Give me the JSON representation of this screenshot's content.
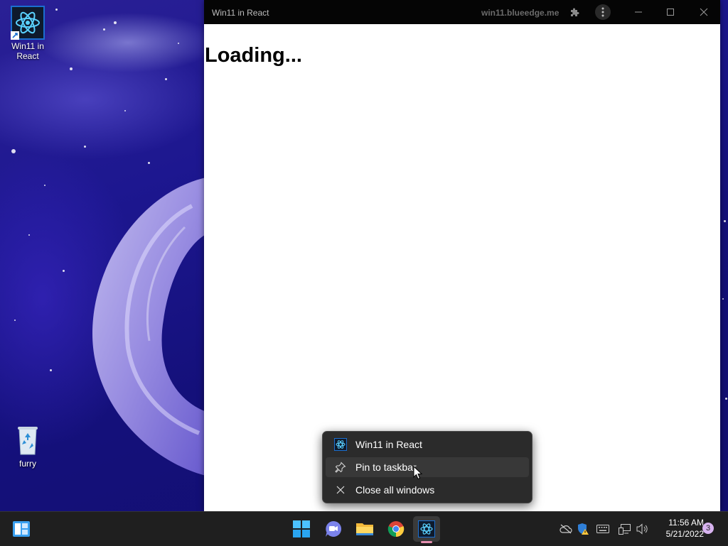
{
  "desktop": {
    "icons": [
      {
        "label": "Win11 in React",
        "icon": "react-atom-icon"
      },
      {
        "label": "furry",
        "icon": "recycle-bin-icon"
      }
    ]
  },
  "window": {
    "title": "Win11 in React",
    "url": "win11.blueedge.me",
    "content_heading": "Loading...",
    "buttons": [
      "extensions-icon",
      "more-options-icon",
      "minimize-icon",
      "maximize-icon",
      "close-icon"
    ]
  },
  "context_menu": {
    "items": [
      {
        "label": "Win11 in React",
        "icon": "react-atom-icon"
      },
      {
        "label": "Pin to taskbar",
        "icon": "pin-icon"
      },
      {
        "label": "Close all windows",
        "icon": "close-icon"
      }
    ]
  },
  "taskbar": {
    "left_icon": "widgets-icon",
    "center_icons": [
      "start-icon",
      "teams-chat-icon",
      "file-explorer-icon",
      "chrome-icon",
      "win11-in-react-icon"
    ],
    "tray_icons": [
      "onedrive-offline-icon",
      "security-warning-icon",
      "keyboard-icon",
      "network-icon",
      "volume-icon"
    ],
    "time": "11:56 AM",
    "date": "5/21/2022",
    "notification_count": "3"
  },
  "colors": {
    "accent": "#0078d4",
    "titlebar": "#050505",
    "taskbar": "#1f1f1f",
    "menu": "#2b2b2b"
  }
}
